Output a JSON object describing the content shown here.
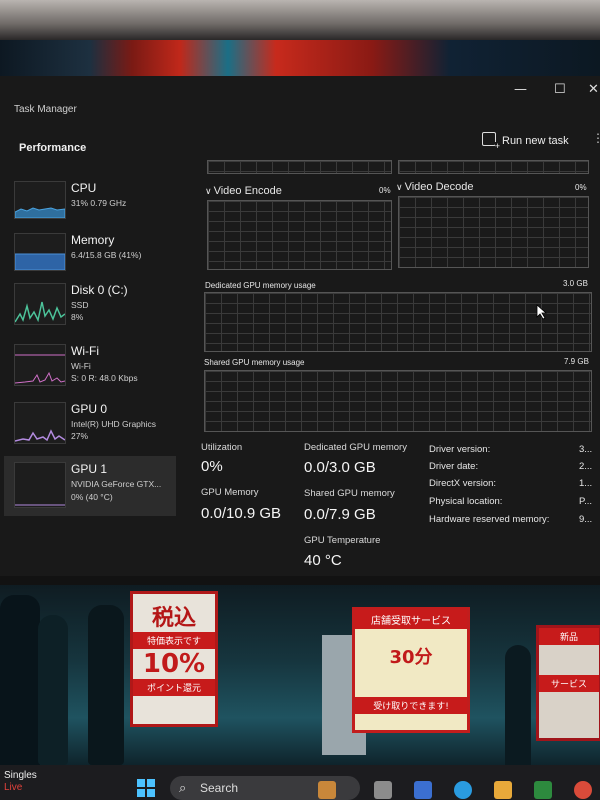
{
  "window": {
    "title": "Task Manager",
    "minimize": "—",
    "maximize": "☐",
    "close": "✕",
    "sidebar_heading": "Performance",
    "run_new_task": "Run new task",
    "more": "⋮"
  },
  "perf_items": [
    {
      "name": "CPU",
      "line1": "31% 0.79 GHz",
      "line2": "",
      "color": "#4aa3e0"
    },
    {
      "name": "Memory",
      "line1": "6.4/15.8 GB (41%)",
      "line2": "",
      "color": "#4a8fd6"
    },
    {
      "name": "Disk 0 (C:)",
      "line1": "SSD",
      "line2": "8%",
      "color": "#4cc39a"
    },
    {
      "name": "Wi-Fi",
      "line1": "Wi-Fi",
      "line2": "S: 0 R: 48.0 Kbps",
      "color": "#d070c8"
    },
    {
      "name": "GPU 0",
      "line1": "Intel(R) UHD Graphics",
      "line2": "27%",
      "color": "#b38be0"
    },
    {
      "name": "GPU 1",
      "line1": "NVIDIA GeForce GTX...",
      "line2": "0% (40 °C)",
      "color": "#b38be0"
    }
  ],
  "engines": {
    "encode_label": "Video Encode",
    "encode_pct": "0%",
    "decode_label": "Video Decode",
    "decode_pct": "0%"
  },
  "memory_graphs": {
    "dedicated_label": "Dedicated GPU memory usage",
    "dedicated_max": "3.0 GB",
    "shared_label": "Shared GPU memory usage",
    "shared_max": "7.9 GB"
  },
  "stats": {
    "utilization_label": "Utilization",
    "utilization_value": "0%",
    "dedicated_label": "Dedicated GPU memory",
    "dedicated_value": "0.0/3.0 GB",
    "gpu_memory_label": "GPU Memory",
    "gpu_memory_value": "0.0/10.9 GB",
    "shared_label": "Shared GPU memory",
    "shared_value": "0.0/7.9 GB",
    "temp_label": "GPU Temperature",
    "temp_value": "40 °C"
  },
  "details": [
    {
      "label": "Driver version:",
      "value": "3..."
    },
    {
      "label": "Driver date:",
      "value": "2..."
    },
    {
      "label": "DirectX version:",
      "value": "1..."
    },
    {
      "label": "Physical location:",
      "value": "P..."
    },
    {
      "label": "Hardware reserved memory:",
      "value": "9..."
    }
  ],
  "signs": {
    "sign1_big": "税込",
    "sign1_red": "特価表示です",
    "sign1_pct": "10%",
    "sign1_small": "ポイント還元",
    "sign2_top": "店舗受取サービス",
    "sign2_mid": "30分",
    "sign2_bottom": "受け取りできます!",
    "sign3_top": "新品",
    "sign3_mid": "サービス"
  },
  "taskbar": {
    "weather_line1": "Singles",
    "weather_line2": "Live",
    "search_icon": "⌕",
    "search_placeholder": "Search"
  }
}
